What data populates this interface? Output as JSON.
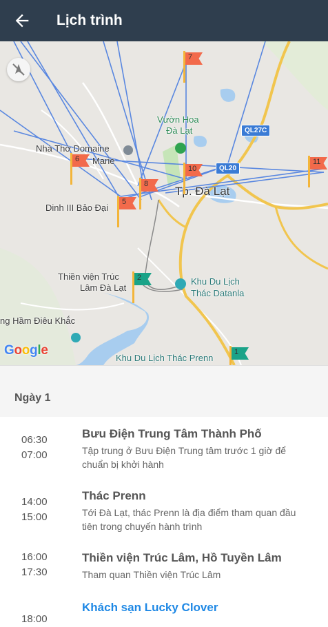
{
  "appbar": {
    "title": "Lịch trình"
  },
  "map": {
    "labels": {
      "vuon_hoa_line1": "Vườn Hoa",
      "vuon_hoa_line2": "Đà Lạt",
      "nha_tho_line1": "Nhà Thờ Domaine",
      "nha_tho_line2": "Marie",
      "dinh_iii": "Dinh III Bảo Đại",
      "city": "Tp. Đà Lạt",
      "thien_vien_line1": "Thiền viện Trúc",
      "thien_vien_line2": "Lâm Đà Lạt",
      "khu_du_lich_datanla_line1": "Khu Du Lịch",
      "khu_du_lich_datanla_line2": "Thác Datanla",
      "duong_ham": "ng Hầm Điêu Khắc",
      "khu_du_lich_prenn": "Khu Du Lịch Thác Prenn",
      "ql27c": "QL27C",
      "ql20": "QL20",
      "google": "Google"
    },
    "markers": [
      "1",
      "2",
      "5",
      "6",
      "7",
      "8",
      "10",
      "11"
    ]
  },
  "day": {
    "title": "Ngày 1"
  },
  "items": [
    {
      "start": "06:30",
      "end": "07:00",
      "name": "Bưu Điện Trung Tâm Thành Phố",
      "desc": "Tập trung ở Bưu Điện Trung tâm trước 1 giờ để chuẩn bị khởi hành"
    },
    {
      "start": "14:00",
      "end": "15:00",
      "name": "Thác Prenn",
      "desc": "Tới Đà Lạt, thác Prenn là địa điểm tham quan đầu tiên trong chuyến hành trình"
    },
    {
      "start": "16:00",
      "end": "17:30",
      "name": "Thiền viện Trúc Lâm, Hồ Tuyền Lâm",
      "desc": "Tham quan Thiền viện Trúc Lâm"
    },
    {
      "start": "18:00",
      "end": "",
      "name": "Khách sạn Lucky Clover",
      "desc": ""
    }
  ]
}
